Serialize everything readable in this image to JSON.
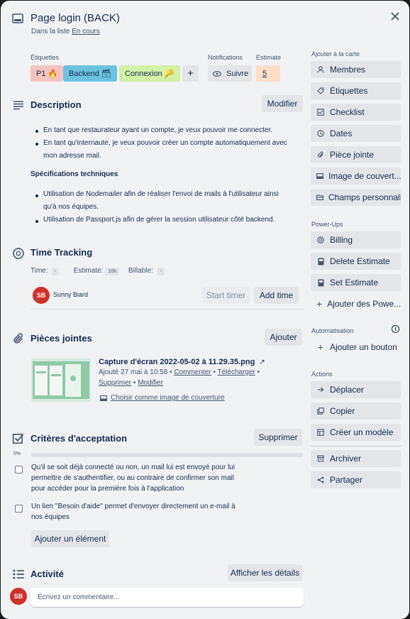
{
  "header": {
    "title": "Page login (BACK)",
    "list_prefix": "Dans la liste",
    "list_name": "En cours"
  },
  "labels": {
    "heading": "Étiquettes",
    "items": [
      {
        "text": "P1 🔥",
        "color": "#f5c4c0"
      },
      {
        "text": "Backend 🗃",
        "color": "#6cc3e0"
      },
      {
        "text": "Connexion 🔑",
        "color": "#d3f1a7"
      }
    ],
    "add": "+"
  },
  "notifications": {
    "heading": "Notifications",
    "watch": "Suivre"
  },
  "estimate": {
    "heading": "Estimate",
    "value": "5",
    "color": "#fedec8"
  },
  "description": {
    "title": "Description",
    "edit": "Modifier",
    "bullets": [
      "En tant que restaurateur ayant un compte, je veux pouvoir me connecter.",
      "En tant qu'internaute, je veux pouvoir créer un compte automatiquement avec",
      "mon adresse mail."
    ],
    "spec_heading": "Spécifications techniques",
    "specs": [
      "Utilisation de Nodemailer afin de réaliser l'envoi de mails à l'utilisateur ainsi",
      "qu'à nos équipes.",
      "Utilisation de Passport.js afin de gérer la session utilisateur côté backend."
    ]
  },
  "time_tracking": {
    "title": "Time Tracking",
    "time_label": "Time:",
    "time_value": "-",
    "estimate_label": "Estimate:",
    "estimate_value": "10h",
    "billable_label": "Billable:",
    "billable_value": "-",
    "user_initials": "SB",
    "user_name": "Sunny Biard",
    "start_timer": "Start timer",
    "add_time": "Add time"
  },
  "attachments": {
    "title": "Pièces jointes",
    "add": "Ajouter",
    "file_name": "Capture d'écran 2022-05-02 à 11.29.35.png",
    "added": "Ajouté 27 mai à 10:58 •",
    "comment": "Commenter",
    "sep1": "•",
    "download": "Télécharger",
    "sep2": "•",
    "delete": "Supprimer",
    "sep3": "•",
    "modify": "Modifier",
    "cover": "Choisir comme image de couverture"
  },
  "checklist": {
    "title": "Critères d'acceptation",
    "delete": "Supprimer",
    "progress": "0%",
    "progress_value": 0,
    "items": [
      {
        "line1": "Qu'il se soit déjà connecté ou non, un mail lui est envoyé pour lui",
        "line2": "permettre de s'authentifier, ou au contraire de confirmer son mail",
        "line3": "pour accéder pour la première fois à l'application"
      },
      {
        "line1": "Un lien \"Besoin d'aide\" permet d'envoyer directement un e-mail à",
        "line2": "nos équipes"
      }
    ],
    "add_item": "Ajouter un élément"
  },
  "activity": {
    "title": "Activité",
    "show_details": "Afficher les détails",
    "user_initials": "SB",
    "placeholder": "Écrivez un commentaire..."
  },
  "sidebar": {
    "add_heading": "Ajouter à la carte",
    "add_items": [
      {
        "label": "Membres",
        "icon": "user-icon"
      },
      {
        "label": "Étiquettes",
        "icon": "tag-icon"
      },
      {
        "label": "Checklist",
        "icon": "checklist-icon"
      },
      {
        "label": "Dates",
        "icon": "clock-icon"
      },
      {
        "label": "Pièce jointe",
        "icon": "paperclip-icon"
      },
      {
        "label": "Image de couvert...",
        "icon": "cover-icon"
      },
      {
        "label": "Champs personnali...",
        "icon": "fields-icon"
      }
    ],
    "powerups_heading": "Power-Ups",
    "powerups": [
      {
        "label": "Billing",
        "icon": "billing-icon"
      },
      {
        "label": "Delete Estimate",
        "icon": "estimate-icon"
      },
      {
        "label": "Set Estimate",
        "icon": "estimate-icon"
      }
    ],
    "add_powerups": "Ajouter des Powe...",
    "automation_heading": "Automatisation",
    "add_button": "Ajouter un bouton",
    "actions_heading": "Actions",
    "actions": [
      {
        "label": "Déplacer",
        "icon": "arrow-right-icon"
      },
      {
        "label": "Copier",
        "icon": "copy-icon"
      },
      {
        "label": "Créer un modèle",
        "icon": "template-icon"
      },
      {
        "label": "Archiver",
        "icon": "archive-icon"
      },
      {
        "label": "Partager",
        "icon": "share-icon"
      }
    ]
  }
}
